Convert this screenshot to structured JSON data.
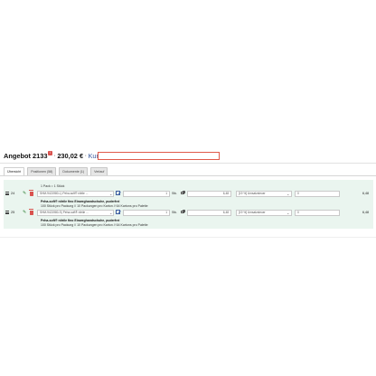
{
  "header": {
    "title": "Angebot 2133",
    "badge": "!",
    "separator_1": "·",
    "total": "230,02 €",
    "separator_2": "·",
    "kunde_label": "Kunde",
    "kunde_value": ""
  },
  "tabs": [
    {
      "label": "Übersicht",
      "active": true
    },
    {
      "label": "Positionen (58)",
      "active": false
    },
    {
      "label": "Dokumente (1)",
      "active": false
    },
    {
      "label": "Verlauf",
      "active": false
    }
  ],
  "pack_info": "1 Pack = 1 Stück",
  "positions": [
    {
      "pos": "24",
      "article": "SHM-9421980-L) Peha-soft® nitrile ...",
      "quantity": "1",
      "unit": "Stk.",
      "price": "6,48",
      "tax": "[19 %] Umsatzsteuer",
      "discount": "0",
      "total": "6,48",
      "desc_title": "Peha-soft® nitrile fino Einweghandschuhe, puderfrei",
      "desc_line1": "100 Stück pro Packung // 10 Packungen pro Karton",
      "desc_line2": "// 64 Kartons pro Palette"
    },
    {
      "pos": "25",
      "article": "SHM-9421980-S) Peha-soft® nitrile ...",
      "quantity": "1",
      "unit": "Stk.",
      "price": "6,48",
      "tax": "[19 %] Umsatzsteuer",
      "discount": "0",
      "total": "6,48",
      "desc_title": "Peha-soft® nitrile fino Einweghandschuhe, puderfrei",
      "desc_line1": "100 Stück pro Packung // 10 Packungen pro Karton",
      "desc_line2": "// 64 Kartons pro Palette"
    }
  ],
  "icons": {
    "drag": "drag-handle-icon",
    "edit": "pencil-icon",
    "delete": "trash-icon",
    "open": "external-link-icon",
    "lock": "lock-icon",
    "dropdown": "chevron-down-icon"
  },
  "colors": {
    "accent": "#3a5ba0",
    "danger": "#d9534f",
    "edit": "#2e7d32",
    "row_background": "#eaf5ef"
  }
}
